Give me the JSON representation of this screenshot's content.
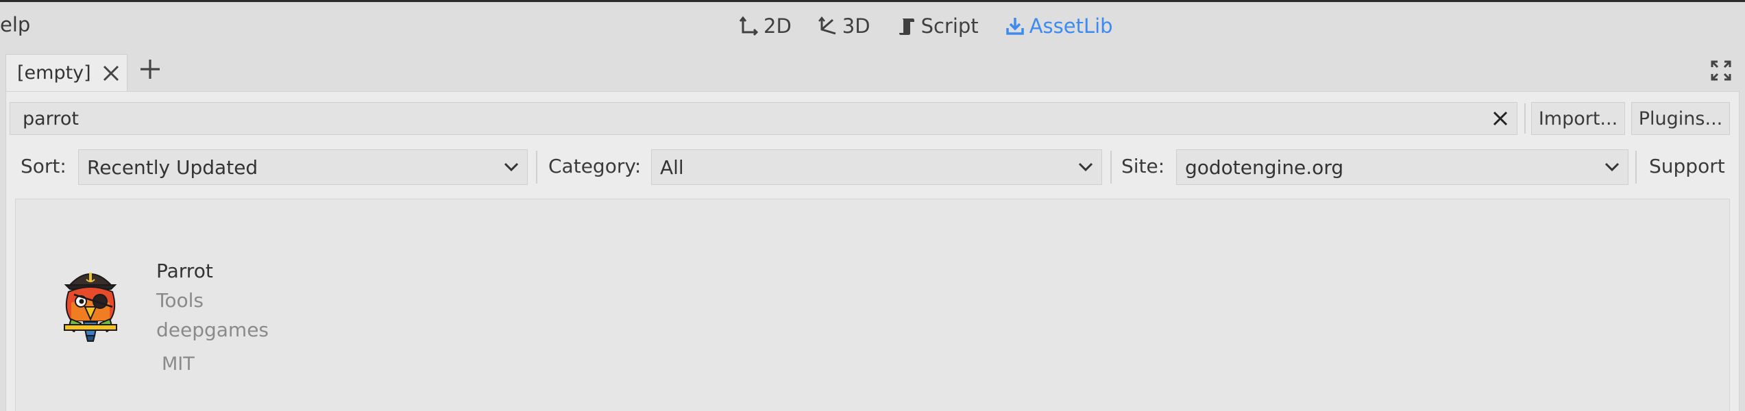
{
  "menu": {
    "help_partial": "elp"
  },
  "main_screen": {
    "buttons": [
      {
        "label": "2D",
        "icon": "2d-icon"
      },
      {
        "label": "3D",
        "icon": "3d-icon"
      },
      {
        "label": "Script",
        "icon": "script-icon"
      },
      {
        "label": "AssetLib",
        "icon": "download-icon",
        "active": true
      }
    ],
    "active_color": "#3d8af0"
  },
  "tabs": [
    {
      "label": "[empty]"
    }
  ],
  "assetlib": {
    "search": {
      "value": "parrot"
    },
    "import_label": "Import...",
    "plugins_label": "Plugins...",
    "sort": {
      "label": "Sort:",
      "value": "Recently Updated"
    },
    "category": {
      "label": "Category:",
      "value": "All"
    },
    "site": {
      "label": "Site:",
      "value": "godotengine.org"
    },
    "support_label": "Support",
    "results": [
      {
        "title": "Parrot",
        "category": "Tools",
        "author": "deepgames",
        "license": "MIT",
        "icon": "parrot-icon"
      }
    ]
  }
}
